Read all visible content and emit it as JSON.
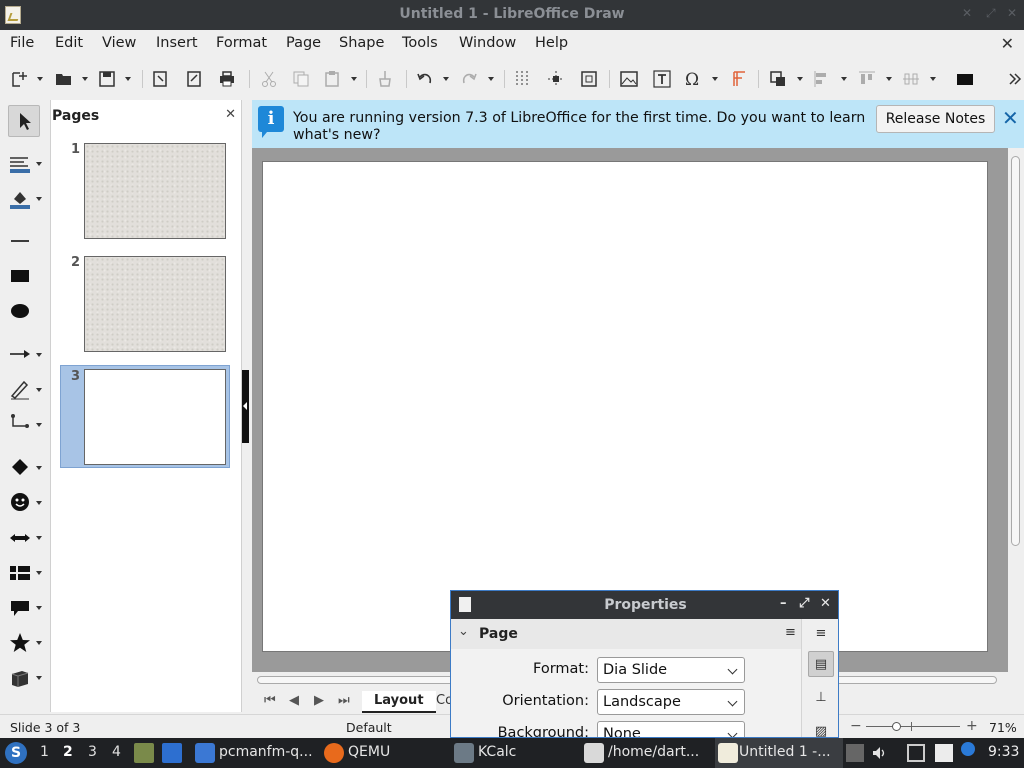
{
  "window": {
    "title": "Untitled 1 - LibreOffice Draw"
  },
  "menubar": {
    "items": [
      "File",
      "Edit",
      "View",
      "Insert",
      "Format",
      "Page",
      "Shape",
      "Tools",
      "Window",
      "Help"
    ]
  },
  "pages_pane": {
    "title": "Pages",
    "pages": [
      {
        "number": "1",
        "style": "textured"
      },
      {
        "number": "2",
        "style": "textured"
      },
      {
        "number": "3",
        "style": "blank",
        "selected": true
      }
    ]
  },
  "infobar": {
    "message": "You are running version 7.3 of LibreOffice for the first time. Do you want to learn what's new?",
    "button": "Release Notes"
  },
  "tabs": {
    "layout": "Layout",
    "controls": "Co"
  },
  "statusbar": {
    "slide": "Slide 3 of 3",
    "master": "Default",
    "zoom": "71%"
  },
  "properties": {
    "title": "Properties",
    "section": "Page",
    "format_label": "Format:",
    "format_value": "Dia Slide",
    "orientation_label": "Orientation:",
    "orientation_value": "Landscape",
    "background_label": "Background:",
    "background_value": "None"
  },
  "taskbar": {
    "workspaces": [
      "1",
      "2",
      "3",
      "4"
    ],
    "current_workspace": "2",
    "tasks": [
      {
        "label": "pcmanfm-q...",
        "icon": "folder-icon"
      },
      {
        "label": "QEMU",
        "icon": "qemu-icon"
      },
      {
        "label": "KCalc",
        "icon": "calculator-icon"
      },
      {
        "label": "/home/dart...",
        "icon": "editor-icon"
      },
      {
        "label": "Untitled 1 -...",
        "icon": "draw-icon"
      }
    ],
    "clock": "9:33"
  },
  "colors": {
    "titlebar": "#323538",
    "infobar": "#bde5f8",
    "accent": "#3d7bc6",
    "taskbar": "#1f2124"
  }
}
